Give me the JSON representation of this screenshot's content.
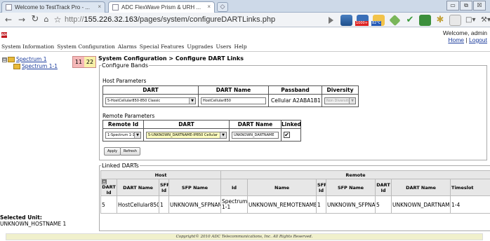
{
  "browser": {
    "tabs": [
      {
        "label": "Welcome to TestTrack Pro - ...",
        "close": "×"
      },
      {
        "label": "ADC FlexWave Prism & URH ...",
        "close": "×"
      }
    ],
    "new_tab_glyph": "◇",
    "window_buttons": [
      "▭",
      "⧉",
      "☒"
    ],
    "url_scheme": "http://",
    "url_host": "155.226.32.163",
    "url_path": "/pages/system/configureDARTLinks.php",
    "ext_badges": {
      "mail_count": "1000+",
      "temp": "82°C"
    },
    "icons": [
      "back-icon",
      "forward-icon",
      "refresh-icon",
      "home-icon",
      "star-icon",
      "play-icon"
    ]
  },
  "header": {
    "logo_text": "ADC",
    "welcome": "Welcome, admin",
    "home_link": "Home",
    "separator": "|",
    "logout_link": "Logout",
    "menu": [
      "System Information",
      "System Configuration",
      "Alarms",
      "Special Features",
      "Upgrades",
      "Users",
      "Help"
    ]
  },
  "tree": {
    "root_expander": "⊟",
    "root": "Spectrum 1",
    "child": "Spectrum 1-1",
    "counts": {
      "red": "11",
      "yellow": "22"
    }
  },
  "page": {
    "title": "System Configuration > Configure DART Links",
    "configure_bands_legend": "Configure Bands",
    "host_params_title": "Host Parameters",
    "host_headers": [
      "DART",
      "DART Name",
      "Passband",
      "Diversity"
    ],
    "host_row": {
      "dart_select": "5-HostCellular850-850 Classic",
      "dart_name": "HostCellular850",
      "passband": "Cellular A2ABA1B1",
      "diversity_select": "Non Diversity"
    },
    "remote_params_title": "Remote Parameters",
    "remote_headers": [
      "Remote Id",
      "DART",
      "DART Name",
      "Linked"
    ],
    "remote_row": {
      "remote_id_select": "1-Spectrum 1-1",
      "dart_select": "5-UNKNOWN_DARTNAME-IP850 Cellular",
      "dart_name": "UNKNOWN_DARTNAME",
      "linked_check": "✔"
    },
    "apply_button": "Apply",
    "refresh_button": "Refresh",
    "select_arrow": "▼",
    "linked_legend": "Linked DARTs",
    "linked_group_headers": {
      "host": "Host",
      "remote": "Remote"
    },
    "linked_headers": [
      "DART Id",
      "DART Name",
      "SFP Id",
      "SFP Name",
      "Id",
      "Name",
      "SFP Id",
      "SFP Name",
      "DART Id",
      "DART Name",
      "Timeslot"
    ],
    "linked_expander": "⊟",
    "linked_rows": [
      [
        "5",
        "HostCellular850",
        "1",
        "UNKNOWN_SFPNAME",
        "Spectrum 1-1",
        "UNKNOWN_REMOTENAME",
        "1",
        "UNKNOWN_SFPNAME",
        "5",
        "UNKNOWN_DARTNAME",
        "1-4"
      ]
    ]
  },
  "selected_unit": {
    "label": "Selected Unit:",
    "value": "UNKNOWN_HOSTNAME 1"
  },
  "footer": {
    "copyright": "Copyright© 2010 ADC Telecommunications, Inc. All Rights Reserved."
  }
}
